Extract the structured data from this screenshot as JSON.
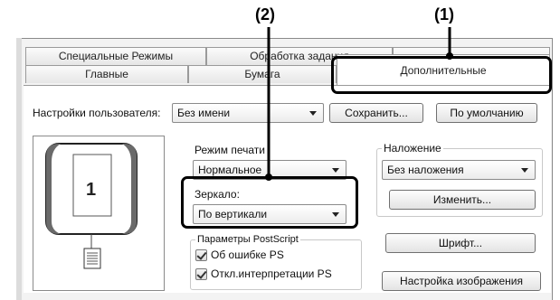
{
  "callouts": {
    "two": "(2)",
    "one": "(1)"
  },
  "tabs": {
    "row1": [
      "Специальные Режимы",
      "Обработка задания",
      ""
    ],
    "row2": [
      "Главные",
      "Бумага"
    ],
    "active": "Дополнительные"
  },
  "user_settings": {
    "label": "Настройки пользователя:",
    "value": "Без имени",
    "save_label": "Сохранить...",
    "default_label": "По умолчанию"
  },
  "preview": {
    "page_number": "1"
  },
  "print_mode": {
    "label": "Режим печати",
    "value": "Нормальное"
  },
  "mirror": {
    "label": "Зеркало:",
    "value": "По вертикали"
  },
  "postscript": {
    "title": "Параметры PostScript",
    "ps_errors": "Об ошибке PS",
    "ps_interpret": "Откл.интерпретации PS"
  },
  "overlay": {
    "title": "Наложение",
    "value": "Без наложения",
    "edit_label": "Изменить..."
  },
  "font_button": "Шрифт...",
  "image_settings_button": "Настройка изображения"
}
